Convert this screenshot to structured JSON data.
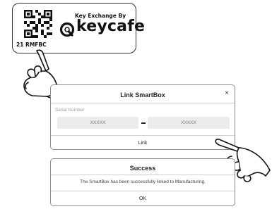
{
  "tag": {
    "brand_by": "Key Exchange By",
    "brand_name": "keycafe",
    "code": "21 RMFBC",
    "icons": {
      "qr": "qr-code-icon",
      "logo": "keycafe-logo-icon"
    }
  },
  "link_dialog": {
    "title": "Link SmartBox",
    "close_label": "×",
    "serial_label": "Serial Number",
    "serial_part1_placeholder": "XXXXX",
    "serial_part1_value": "",
    "serial_part2_placeholder": "XXXXX",
    "serial_part2_value": "",
    "link_label": "Link"
  },
  "success_dialog": {
    "title": "Success",
    "message": "The SmartBox has been successfully linked to Manufacturing.",
    "ok_label": "OK"
  },
  "hands": [
    "pointing-hand-icon",
    "pointing-hand-icon"
  ],
  "colors": {
    "border": "#8a8a8a",
    "input_bg": "#ececec",
    "text": "#222222",
    "muted": "#9a9a9a"
  }
}
